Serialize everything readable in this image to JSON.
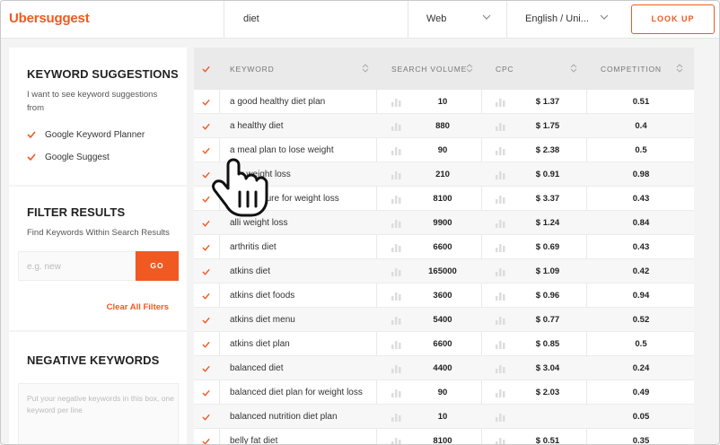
{
  "header": {
    "logo": "Ubersuggest",
    "search_value": "diet",
    "search_type": "Web",
    "language": "English / Uni...",
    "lookup_label": "LOOK UP"
  },
  "sidebar": {
    "suggestions": {
      "title": "KEYWORD SUGGESTIONS",
      "subtitle": "I want to see keyword suggestions from",
      "options": [
        "Google Keyword Planner",
        "Google Suggest"
      ]
    },
    "filter": {
      "title": "FILTER RESULTS",
      "subtitle": "Find Keywords Within Search Results",
      "placeholder": "e.g. new",
      "go_label": "GO",
      "clear_label": "Clear All Filters"
    },
    "negative": {
      "title": "NEGATIVE KEYWORDS",
      "placeholder": "Put your negative keywords in this box, one keyword per line"
    }
  },
  "table": {
    "headers": {
      "keyword": "KEYWORD",
      "volume": "SEARCH VOLUME",
      "cpc": "CPC",
      "competition": "COMPETITION"
    },
    "rows": [
      {
        "keyword": "a good healthy diet plan",
        "volume": "10",
        "cpc": "$ 1.37",
        "competition": "0.51"
      },
      {
        "keyword": "a healthy diet",
        "volume": "880",
        "cpc": "$ 1.75",
        "competition": "0.4"
      },
      {
        "keyword": "a meal plan to lose weight",
        "volume": "90",
        "cpc": "$ 2.38",
        "competition": "0.5"
      },
      {
        "keyword": "acv weight loss",
        "volume": "210",
        "cpc": "$ 0.91",
        "competition": "0.98"
      },
      {
        "keyword": "acupuncture for weight loss",
        "volume": "8100",
        "cpc": "$ 3.37",
        "competition": "0.43"
      },
      {
        "keyword": "alli weight loss",
        "volume": "9900",
        "cpc": "$ 1.24",
        "competition": "0.84"
      },
      {
        "keyword": "arthritis diet",
        "volume": "6600",
        "cpc": "$ 0.69",
        "competition": "0.43"
      },
      {
        "keyword": "atkins diet",
        "volume": "165000",
        "cpc": "$ 1.09",
        "competition": "0.42"
      },
      {
        "keyword": "atkins diet foods",
        "volume": "3600",
        "cpc": "$ 0.96",
        "competition": "0.94"
      },
      {
        "keyword": "atkins diet menu",
        "volume": "5400",
        "cpc": "$ 0.77",
        "competition": "0.52"
      },
      {
        "keyword": "atkins diet plan",
        "volume": "6600",
        "cpc": "$ 0.85",
        "competition": "0.5"
      },
      {
        "keyword": "balanced diet",
        "volume": "4400",
        "cpc": "$ 3.04",
        "competition": "0.24"
      },
      {
        "keyword": "balanced diet plan for weight loss",
        "volume": "90",
        "cpc": "$ 2.03",
        "competition": "0.49"
      },
      {
        "keyword": "balanced nutrition diet plan",
        "volume": "10",
        "cpc": "",
        "competition": "0.05"
      },
      {
        "keyword": "belly fat diet",
        "volume": "8100",
        "cpc": "$ 0.51",
        "competition": "0.35"
      }
    ]
  },
  "colors": {
    "accent": "#f05a22"
  },
  "icons": {
    "row_check": "checkmark-icon",
    "chart": "bar-chart-icon",
    "sort": "sort-arrows-icon",
    "cursor": "hand-pointer-icon"
  }
}
